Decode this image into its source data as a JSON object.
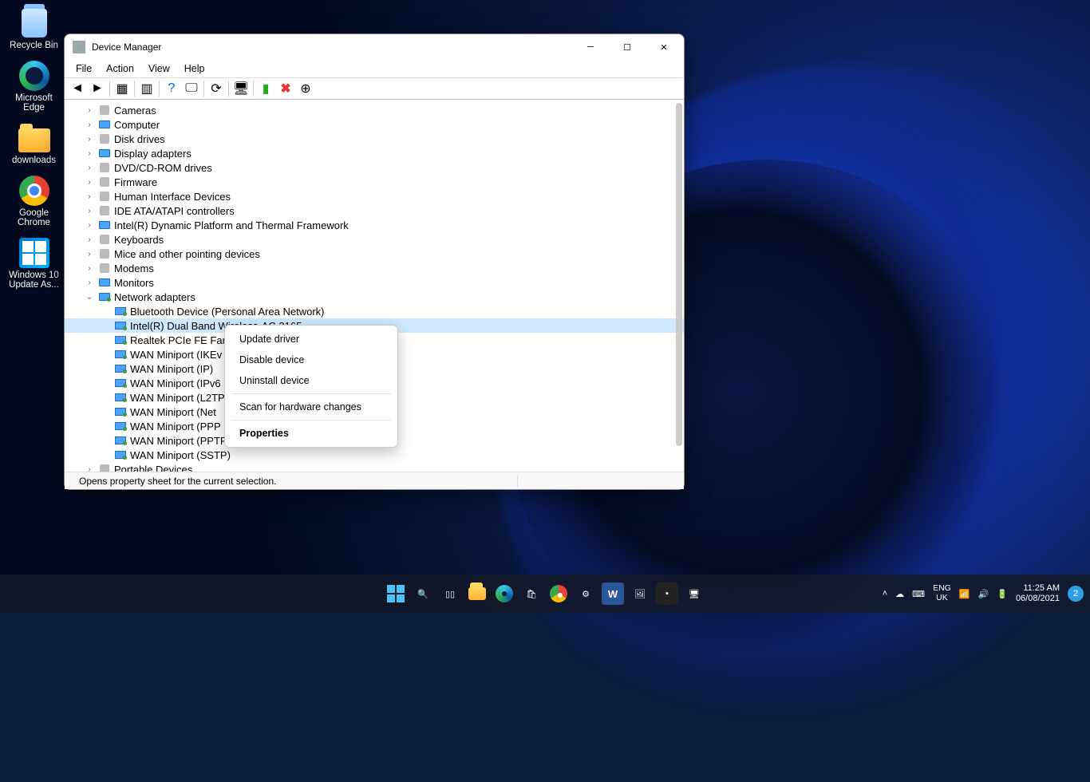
{
  "desktop": {
    "icons": [
      {
        "label": "Recycle Bin",
        "kind": "bin"
      },
      {
        "label": "Microsoft Edge",
        "kind": "edge"
      },
      {
        "label": "downloads",
        "kind": "folder"
      },
      {
        "label": "Google Chrome",
        "kind": "chrome"
      },
      {
        "label": "Windows 10 Update As...",
        "kind": "winupd"
      }
    ]
  },
  "window": {
    "title": "Device Manager",
    "menus": [
      "File",
      "Action",
      "View",
      "Help"
    ],
    "status": "Opens property sheet for the current selection."
  },
  "tree": {
    "items": [
      {
        "label": "Cameras",
        "icon": "gen",
        "exp": ">"
      },
      {
        "label": "Computer",
        "icon": "mon",
        "exp": ">"
      },
      {
        "label": "Disk drives",
        "icon": "gen",
        "exp": ">"
      },
      {
        "label": "Display adapters",
        "icon": "mon",
        "exp": ">"
      },
      {
        "label": "DVD/CD-ROM drives",
        "icon": "gen",
        "exp": ">"
      },
      {
        "label": "Firmware",
        "icon": "gen",
        "exp": ">"
      },
      {
        "label": "Human Interface Devices",
        "icon": "gen",
        "exp": ">"
      },
      {
        "label": "IDE ATA/ATAPI controllers",
        "icon": "gen",
        "exp": ">"
      },
      {
        "label": "Intel(R) Dynamic Platform and Thermal Framework",
        "icon": "mon",
        "exp": ">"
      },
      {
        "label": "Keyboards",
        "icon": "gen",
        "exp": ">"
      },
      {
        "label": "Mice and other pointing devices",
        "icon": "gen",
        "exp": ">"
      },
      {
        "label": "Modems",
        "icon": "gen",
        "exp": ">"
      },
      {
        "label": "Monitors",
        "icon": "mon",
        "exp": ">"
      },
      {
        "label": "Network adapters",
        "icon": "neti",
        "exp": "v",
        "children": [
          {
            "label": "Bluetooth Device (Personal Area Network)"
          },
          {
            "label": "Intel(R) Dual Band Wireless-AC 3165",
            "selected": true
          },
          {
            "label": "Realtek PCIe FE Fam"
          },
          {
            "label": "WAN Miniport (IKEv"
          },
          {
            "label": "WAN Miniport (IP)"
          },
          {
            "label": "WAN Miniport (IPv6"
          },
          {
            "label": "WAN Miniport (L2TP"
          },
          {
            "label": "WAN Miniport (Net"
          },
          {
            "label": "WAN Miniport (PPP"
          },
          {
            "label": "WAN Miniport (PPTP)"
          },
          {
            "label": "WAN Miniport (SSTP)"
          }
        ]
      },
      {
        "label": "Portable Devices",
        "icon": "gen",
        "exp": ">"
      }
    ]
  },
  "context_menu": {
    "items": [
      {
        "label": "Update driver"
      },
      {
        "label": "Disable device"
      },
      {
        "label": "Uninstall device"
      },
      {
        "sep": true
      },
      {
        "label": "Scan for hardware changes"
      },
      {
        "sep": true
      },
      {
        "label": "Properties",
        "bold": true
      }
    ]
  },
  "taskbar": {
    "lang1": "ENG",
    "lang2": "UK",
    "time": "11:25 AM",
    "date": "06/08/2021",
    "notif_count": "2"
  }
}
